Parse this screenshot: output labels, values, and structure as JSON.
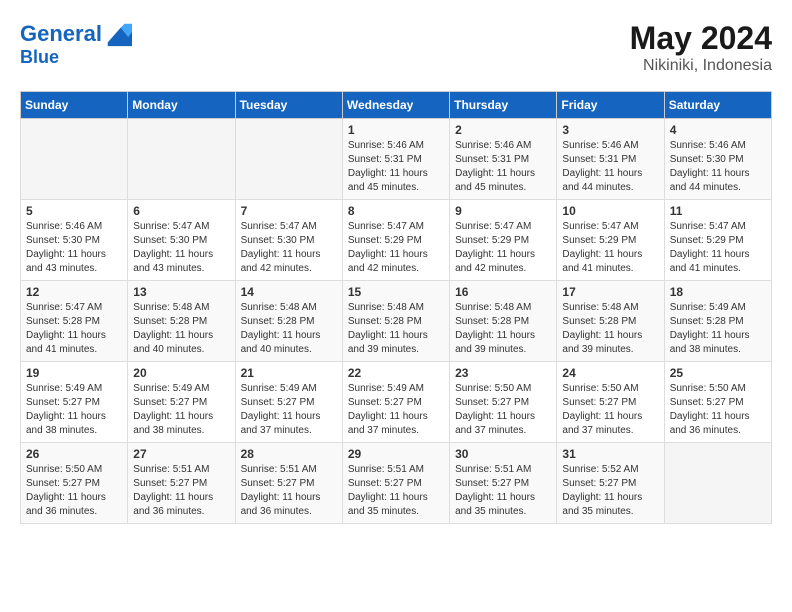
{
  "logo": {
    "line1": "General",
    "line2": "Blue"
  },
  "title": "May 2024",
  "location": "Nikiniki, Indonesia",
  "headers": [
    "Sunday",
    "Monday",
    "Tuesday",
    "Wednesday",
    "Thursday",
    "Friday",
    "Saturday"
  ],
  "weeks": [
    [
      {
        "day": "",
        "info": ""
      },
      {
        "day": "",
        "info": ""
      },
      {
        "day": "",
        "info": ""
      },
      {
        "day": "1",
        "info": "Sunrise: 5:46 AM\nSunset: 5:31 PM\nDaylight: 11 hours and 45 minutes."
      },
      {
        "day": "2",
        "info": "Sunrise: 5:46 AM\nSunset: 5:31 PM\nDaylight: 11 hours and 45 minutes."
      },
      {
        "day": "3",
        "info": "Sunrise: 5:46 AM\nSunset: 5:31 PM\nDaylight: 11 hours and 44 minutes."
      },
      {
        "day": "4",
        "info": "Sunrise: 5:46 AM\nSunset: 5:30 PM\nDaylight: 11 hours and 44 minutes."
      }
    ],
    [
      {
        "day": "5",
        "info": "Sunrise: 5:46 AM\nSunset: 5:30 PM\nDaylight: 11 hours and 43 minutes."
      },
      {
        "day": "6",
        "info": "Sunrise: 5:47 AM\nSunset: 5:30 PM\nDaylight: 11 hours and 43 minutes."
      },
      {
        "day": "7",
        "info": "Sunrise: 5:47 AM\nSunset: 5:30 PM\nDaylight: 11 hours and 42 minutes."
      },
      {
        "day": "8",
        "info": "Sunrise: 5:47 AM\nSunset: 5:29 PM\nDaylight: 11 hours and 42 minutes."
      },
      {
        "day": "9",
        "info": "Sunrise: 5:47 AM\nSunset: 5:29 PM\nDaylight: 11 hours and 42 minutes."
      },
      {
        "day": "10",
        "info": "Sunrise: 5:47 AM\nSunset: 5:29 PM\nDaylight: 11 hours and 41 minutes."
      },
      {
        "day": "11",
        "info": "Sunrise: 5:47 AM\nSunset: 5:29 PM\nDaylight: 11 hours and 41 minutes."
      }
    ],
    [
      {
        "day": "12",
        "info": "Sunrise: 5:47 AM\nSunset: 5:28 PM\nDaylight: 11 hours and 41 minutes."
      },
      {
        "day": "13",
        "info": "Sunrise: 5:48 AM\nSunset: 5:28 PM\nDaylight: 11 hours and 40 minutes."
      },
      {
        "day": "14",
        "info": "Sunrise: 5:48 AM\nSunset: 5:28 PM\nDaylight: 11 hours and 40 minutes."
      },
      {
        "day": "15",
        "info": "Sunrise: 5:48 AM\nSunset: 5:28 PM\nDaylight: 11 hours and 39 minutes."
      },
      {
        "day": "16",
        "info": "Sunrise: 5:48 AM\nSunset: 5:28 PM\nDaylight: 11 hours and 39 minutes."
      },
      {
        "day": "17",
        "info": "Sunrise: 5:48 AM\nSunset: 5:28 PM\nDaylight: 11 hours and 39 minutes."
      },
      {
        "day": "18",
        "info": "Sunrise: 5:49 AM\nSunset: 5:28 PM\nDaylight: 11 hours and 38 minutes."
      }
    ],
    [
      {
        "day": "19",
        "info": "Sunrise: 5:49 AM\nSunset: 5:27 PM\nDaylight: 11 hours and 38 minutes."
      },
      {
        "day": "20",
        "info": "Sunrise: 5:49 AM\nSunset: 5:27 PM\nDaylight: 11 hours and 38 minutes."
      },
      {
        "day": "21",
        "info": "Sunrise: 5:49 AM\nSunset: 5:27 PM\nDaylight: 11 hours and 37 minutes."
      },
      {
        "day": "22",
        "info": "Sunrise: 5:49 AM\nSunset: 5:27 PM\nDaylight: 11 hours and 37 minutes."
      },
      {
        "day": "23",
        "info": "Sunrise: 5:50 AM\nSunset: 5:27 PM\nDaylight: 11 hours and 37 minutes."
      },
      {
        "day": "24",
        "info": "Sunrise: 5:50 AM\nSunset: 5:27 PM\nDaylight: 11 hours and 37 minutes."
      },
      {
        "day": "25",
        "info": "Sunrise: 5:50 AM\nSunset: 5:27 PM\nDaylight: 11 hours and 36 minutes."
      }
    ],
    [
      {
        "day": "26",
        "info": "Sunrise: 5:50 AM\nSunset: 5:27 PM\nDaylight: 11 hours and 36 minutes."
      },
      {
        "day": "27",
        "info": "Sunrise: 5:51 AM\nSunset: 5:27 PM\nDaylight: 11 hours and 36 minutes."
      },
      {
        "day": "28",
        "info": "Sunrise: 5:51 AM\nSunset: 5:27 PM\nDaylight: 11 hours and 36 minutes."
      },
      {
        "day": "29",
        "info": "Sunrise: 5:51 AM\nSunset: 5:27 PM\nDaylight: 11 hours and 35 minutes."
      },
      {
        "day": "30",
        "info": "Sunrise: 5:51 AM\nSunset: 5:27 PM\nDaylight: 11 hours and 35 minutes."
      },
      {
        "day": "31",
        "info": "Sunrise: 5:52 AM\nSunset: 5:27 PM\nDaylight: 11 hours and 35 minutes."
      },
      {
        "day": "",
        "info": ""
      }
    ]
  ]
}
